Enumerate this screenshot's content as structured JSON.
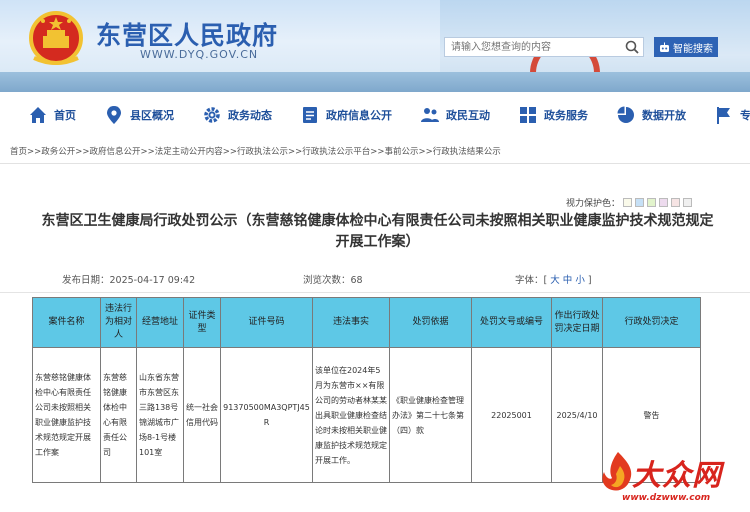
{
  "header": {
    "site_title": "东营区人民政府",
    "site_url": "WWW.DYQ.GOV.CN",
    "search_placeholder": "请输入您想查询的内容",
    "smart_search_label": "智能搜索",
    "colors": {
      "brand": "#2b5fb0",
      "accent_red": "#d8241d"
    }
  },
  "nav": {
    "items": [
      {
        "label": "首页",
        "icon": "home-icon"
      },
      {
        "label": "县区概况",
        "icon": "map-pin-icon"
      },
      {
        "label": "政务动态",
        "icon": "gear-icon"
      },
      {
        "label": "政府信息公开",
        "icon": "document-icon"
      },
      {
        "label": "政民互动",
        "icon": "people-icon"
      },
      {
        "label": "政务服务",
        "icon": "grid-icon"
      },
      {
        "label": "数据开放",
        "icon": "pie-chart-icon"
      },
      {
        "label": "专题专栏",
        "icon": "flag-icon"
      }
    ]
  },
  "breadcrumb": "首页>>政务公开>>政府信息公开>>法定主动公开内容>>行政执法公示>>行政执法公示平台>>事前公示>>行政执法结果公示",
  "article": {
    "vision_label": "视力保护色：",
    "vision_swatches": [
      "#fafaea",
      "#c6e0f6",
      "#e2f4cc",
      "#eddbee",
      "#f6e4e4",
      "#f0f0f0"
    ],
    "title": "东营区卫生健康局行政处罚公示（东营慈铭健康体检中心有限责任公司未按照相关职业健康监护技术规范规定开展工作案）",
    "publish_date": "发布日期：2025-04-17 09:42",
    "views": "浏览次数：68",
    "font_label": "字体：[",
    "font_large": "大",
    "font_medium": "中",
    "font_small": "小",
    "font_close": "]"
  },
  "table": {
    "headers": [
      "案件名称",
      "违法行为相对人",
      "经营地址",
      "证件类型",
      "证件号码",
      "违法事实",
      "处罚依据",
      "处罚文号或编号",
      "作出行政处罚决定日期",
      "行政处罚决定"
    ],
    "row": [
      "东营慈铭健康体检中心有限责任公司未按照相关职业健康监护技术规范规定开展工作案",
      "东营慈铭健康体检中心有限责任公司",
      "山东省东营市东营区东三路138号锦湖城市广场8-1号楼101室",
      "统一社会信用代码",
      "91370500MA3QPTJ45R",
      "该单位在2024年5月为东营市××有限公司的劳动者林某某出具职业健康检查结论时未按相关职业健康监护技术规范规定开展工作。",
      "《职业健康检查管理办法》第二十七条第（四）款",
      "22025001",
      "2025/4/10",
      "警告"
    ]
  },
  "watermark": {
    "text": "大众网",
    "url": "www.dzwww.com"
  }
}
